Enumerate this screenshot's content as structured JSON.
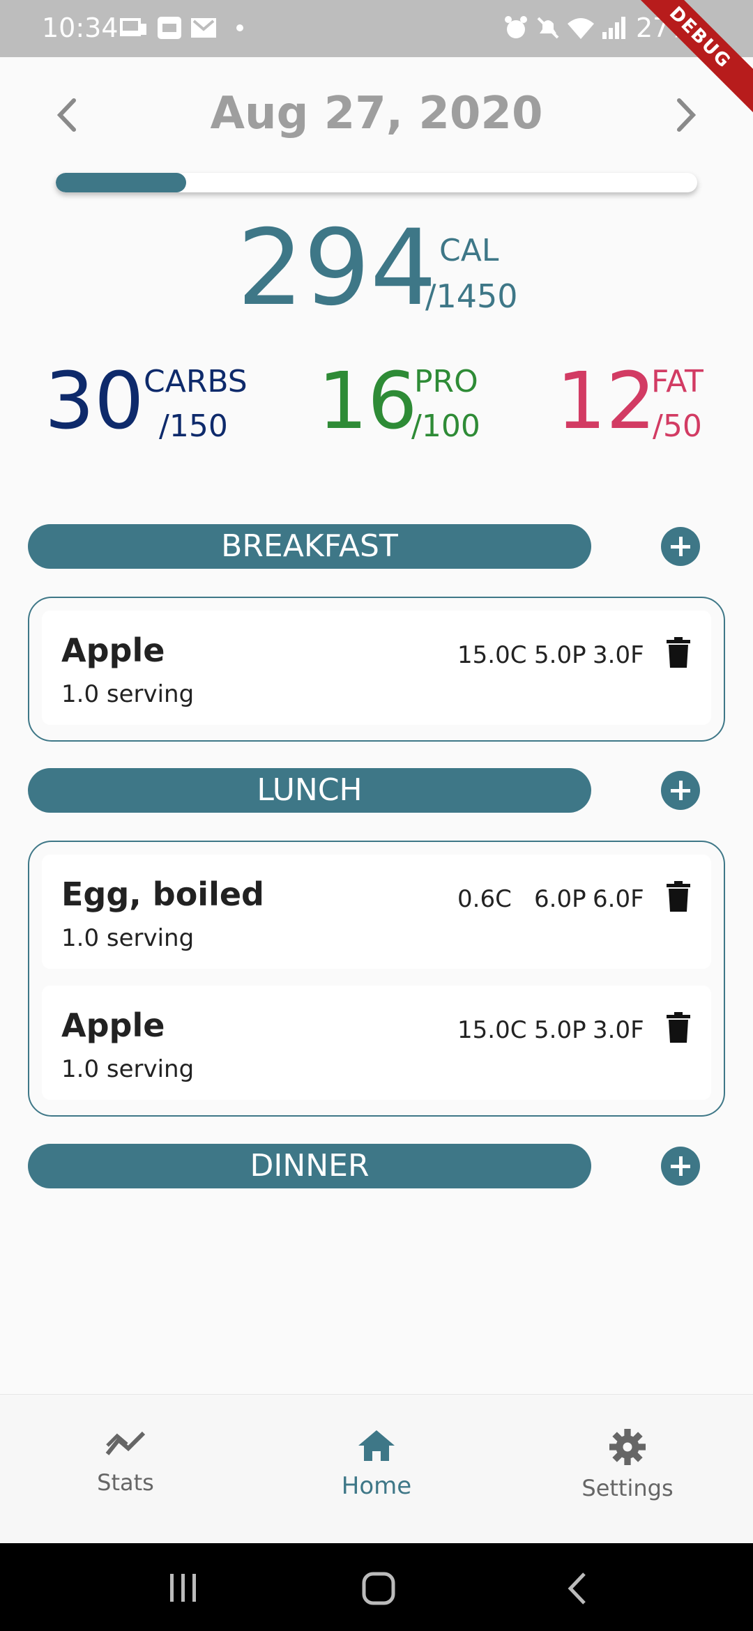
{
  "status_bar": {
    "time": "10:34",
    "battery": "27%"
  },
  "debug_banner": "DEBUG",
  "header": {
    "date": "Aug 27, 2020"
  },
  "progress": {
    "fraction": 0.2028
  },
  "calories": {
    "value": "294",
    "label": "CAL",
    "goal": "/1450"
  },
  "macros": {
    "carbs": {
      "value": "30",
      "label": "CARBS",
      "goal": "/150"
    },
    "protein": {
      "value": "16",
      "label": "PRO",
      "goal": "/100"
    },
    "fat": {
      "value": "12",
      "label": "FAT",
      "goal": "/50"
    }
  },
  "meals": [
    {
      "title": "BREAKFAST",
      "items": [
        {
          "name": "Apple",
          "serving": "1.0 serving",
          "carbs": "15.0C",
          "protein": "5.0P",
          "fat": "3.0F"
        }
      ]
    },
    {
      "title": "LUNCH",
      "items": [
        {
          "name": "Egg, boiled",
          "serving": "1.0 serving",
          "carbs": "0.6C",
          "protein": "6.0P",
          "fat": "6.0F"
        },
        {
          "name": "Apple",
          "serving": "1.0 serving",
          "carbs": "15.0C",
          "protein": "5.0P",
          "fat": "3.0F"
        }
      ]
    },
    {
      "title": "DINNER",
      "items": []
    }
  ],
  "bottom_nav": {
    "stats": "Stats",
    "home": "Home",
    "settings": "Settings"
  },
  "colors": {
    "accent": "#3e7787",
    "carbs": "#0e2a6b",
    "protein": "#2e8b36",
    "fat": "#d23b63"
  }
}
